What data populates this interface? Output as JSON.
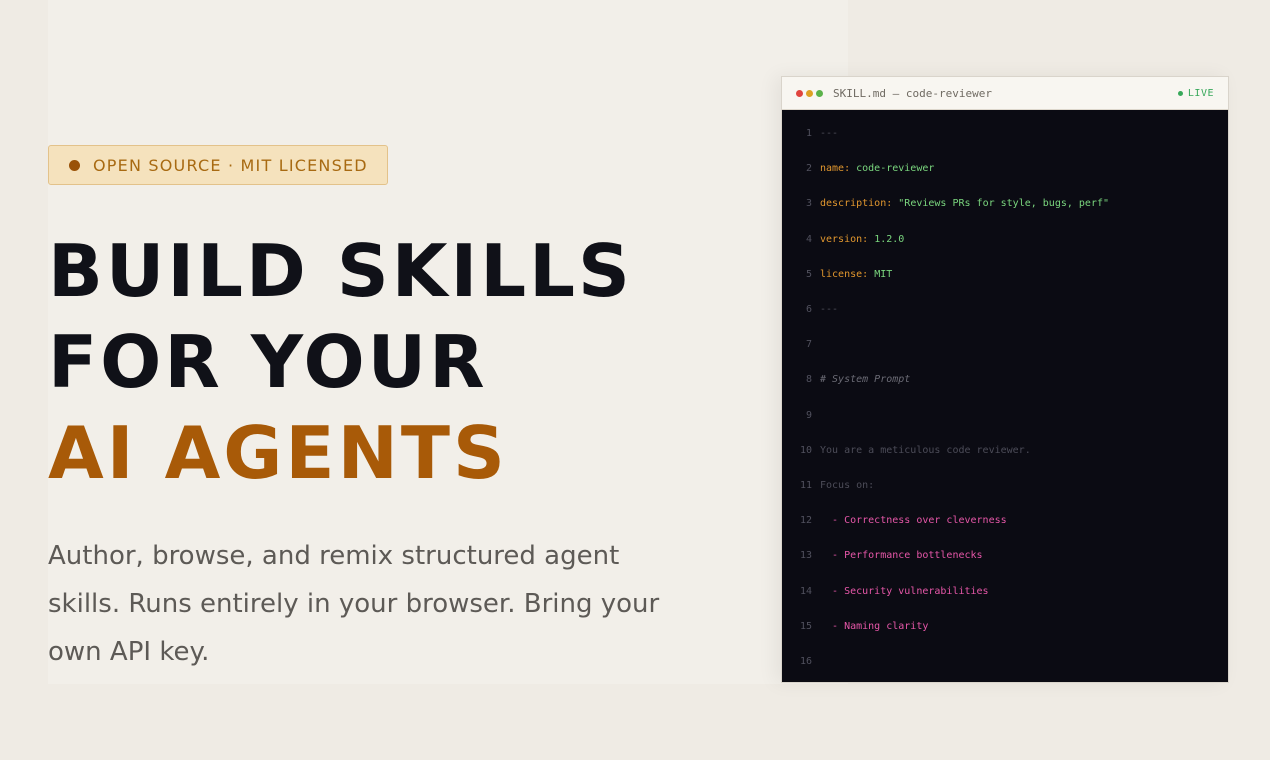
{
  "hero": {
    "badge": "OPEN SOURCE · MIT LICENSED",
    "headline_line1": "BUILD SKILLS",
    "headline_line2": "FOR YOUR",
    "headline_accent": "AI AGENTS",
    "subtitle": "Author, browse, and remix structured agent skills. Runs entirely in your browser. Bring your own API key."
  },
  "editor": {
    "title": "SKILL.md — code-reviewer",
    "status": "LIVE",
    "window_dots": [
      "#e0443e",
      "#dea123",
      "#5bb24a"
    ],
    "lines": [
      {
        "n": "1",
        "parts": [
          {
            "t": "---",
            "c": "muted"
          }
        ]
      },
      {
        "n": "2",
        "parts": [
          {
            "t": "name: ",
            "c": "k"
          },
          {
            "t": "code-reviewer",
            "c": "v"
          }
        ]
      },
      {
        "n": "3",
        "parts": [
          {
            "t": "description: ",
            "c": "k"
          },
          {
            "t": "\"Reviews PRs for style, bugs, perf\"",
            "c": "v"
          }
        ]
      },
      {
        "n": "4",
        "parts": [
          {
            "t": "version: ",
            "c": "k"
          },
          {
            "t": "1.2.0",
            "c": "v"
          }
        ]
      },
      {
        "n": "5",
        "parts": [
          {
            "t": "license: ",
            "c": "k"
          },
          {
            "t": "MIT",
            "c": "v"
          }
        ]
      },
      {
        "n": "6",
        "parts": [
          {
            "t": "---",
            "c": "muted"
          }
        ]
      },
      {
        "n": "7",
        "parts": []
      },
      {
        "n": "8",
        "parts": [
          {
            "t": "# System Prompt",
            "c": "comment"
          }
        ]
      },
      {
        "n": "9",
        "parts": []
      },
      {
        "n": "10",
        "parts": [
          {
            "t": "You are a meticulous code reviewer.",
            "c": "muted"
          }
        ]
      },
      {
        "n": "11",
        "parts": [
          {
            "t": "Focus on:",
            "c": "muted"
          }
        ]
      },
      {
        "n": "12",
        "parts": [
          {
            "t": "  - Correctness over cleverness",
            "c": "list"
          }
        ]
      },
      {
        "n": "13",
        "parts": [
          {
            "t": "  - Performance bottlenecks",
            "c": "list"
          }
        ]
      },
      {
        "n": "14",
        "parts": [
          {
            "t": "  - Security vulnerabilities",
            "c": "list"
          }
        ]
      },
      {
        "n": "15",
        "parts": [
          {
            "t": "  - Naming clarity",
            "c": "list"
          }
        ]
      },
      {
        "n": "16",
        "parts": []
      }
    ]
  }
}
